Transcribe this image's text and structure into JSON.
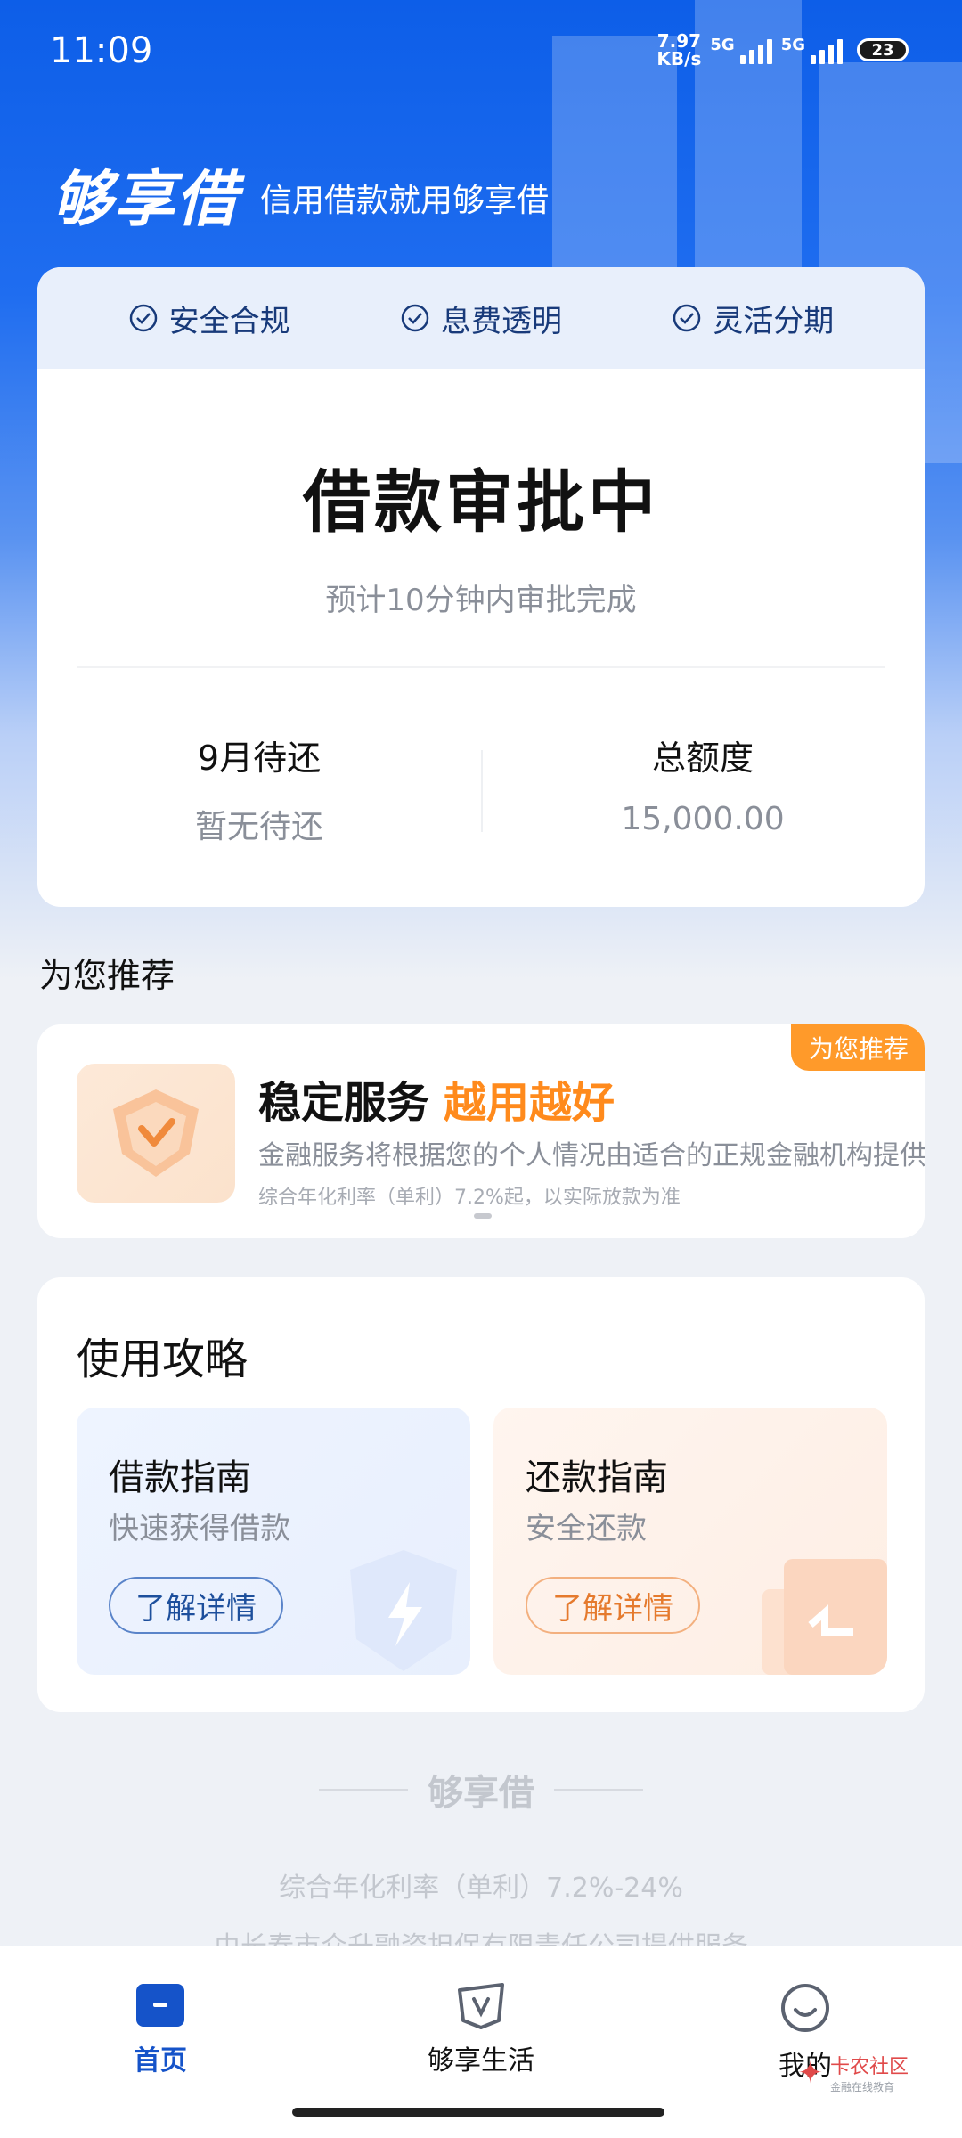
{
  "status_bar": {
    "time": "11:09",
    "net_speed_value": "7.97",
    "net_speed_unit": "KB/s",
    "signal_1": "5G",
    "signal_2": "5G",
    "battery": "23"
  },
  "brand": {
    "logo": "够享借",
    "slogan": "信用借款就用够享借"
  },
  "badges": [
    "安全合规",
    "息费透明",
    "灵活分期"
  ],
  "approval": {
    "title": "借款审批中",
    "subtitle": "预计10分钟内审批完成"
  },
  "stats": {
    "pending_label": "9月待还",
    "pending_value": "暂无待还",
    "limit_label": "总额度",
    "limit_value": "15,000.00"
  },
  "recommend": {
    "section_title": "为您推荐",
    "tag": "为您推荐",
    "title": "稳定服务",
    "highlight": "越用越好",
    "description": "金融服务将根据您的个人情况由适合的正规金融机构提供",
    "note": "综合年化利率（单利）7.2%起，以实际放款为准"
  },
  "guide": {
    "title": "使用攻略",
    "loan": {
      "title": "借款指南",
      "subtitle": "快速获得借款",
      "button": "了解详情"
    },
    "repay": {
      "title": "还款指南",
      "subtitle": "安全还款",
      "button": "了解详情"
    }
  },
  "footer": {
    "brand": "够享借",
    "rate": "综合年化利率（单利）7.2%-24%",
    "provider": "由长春市众升融资担保有限责任公司提供服务"
  },
  "tabs": [
    {
      "label": "首页",
      "icon": "home-icon",
      "active": true
    },
    {
      "label": "够享生活",
      "icon": "life-icon",
      "active": false
    },
    {
      "label": "我的",
      "icon": "profile-icon",
      "active": false
    }
  ],
  "watermark": {
    "main": "卡农社区",
    "sub": "金融在线教育"
  },
  "colors": {
    "brand_blue": "#1553c9",
    "accent_orange": "#ff8a1c"
  }
}
